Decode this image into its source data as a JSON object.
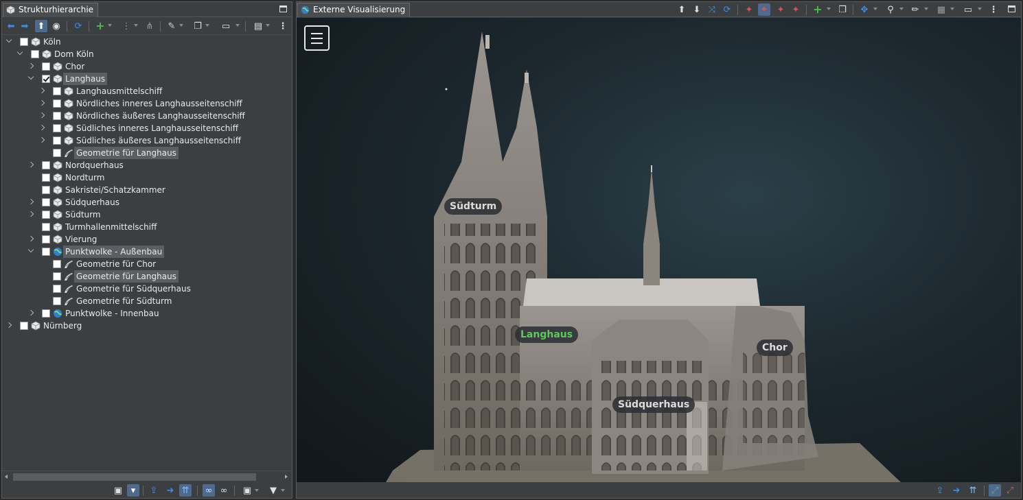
{
  "left_panel": {
    "tab_title": "Strukturhierarchie",
    "tree": [
      {
        "label": "Köln",
        "depth": 0,
        "expander": "down",
        "checked": false,
        "icon": "cube-icon",
        "selected": false
      },
      {
        "label": "Dom Köln",
        "depth": 1,
        "expander": "down",
        "checked": false,
        "icon": "cube-icon",
        "selected": false
      },
      {
        "label": "Chor",
        "depth": 2,
        "expander": "right",
        "checked": false,
        "icon": "cube-icon",
        "selected": false
      },
      {
        "label": "Langhaus",
        "depth": 2,
        "expander": "down",
        "checked": true,
        "icon": "cube-icon",
        "selected": true
      },
      {
        "label": "Langhausmittelschiff",
        "depth": 3,
        "expander": "right",
        "checked": false,
        "icon": "cube-icon",
        "selected": false
      },
      {
        "label": "Nördliches inneres Langhausseitenschiff",
        "depth": 3,
        "expander": "right",
        "checked": false,
        "icon": "cube-icon",
        "selected": false
      },
      {
        "label": "Nördliches äußeres Langhausseitenschiff",
        "depth": 3,
        "expander": "right",
        "checked": false,
        "icon": "cube-icon",
        "selected": false
      },
      {
        "label": "Südliches inneres Langhausseitenschiff",
        "depth": 3,
        "expander": "right",
        "checked": false,
        "icon": "cube-icon",
        "selected": false
      },
      {
        "label": "Südliches äußeres Langhausseitenschiff",
        "depth": 3,
        "expander": "right",
        "checked": false,
        "icon": "cube-icon",
        "selected": false
      },
      {
        "label": "Geometrie für Langhaus",
        "depth": 3,
        "expander": "none",
        "checked": false,
        "icon": "geometry-icon",
        "selected": true
      },
      {
        "label": "Nordquerhaus",
        "depth": 2,
        "expander": "right",
        "checked": false,
        "icon": "cube-icon",
        "selected": false
      },
      {
        "label": "Nordturm",
        "depth": 2,
        "expander": "none",
        "checked": false,
        "icon": "cube-icon",
        "selected": false
      },
      {
        "label": "Sakristei/Schatzkammer",
        "depth": 2,
        "expander": "none",
        "checked": false,
        "icon": "cube-icon",
        "selected": false
      },
      {
        "label": "Südquerhaus",
        "depth": 2,
        "expander": "right",
        "checked": false,
        "icon": "cube-icon",
        "selected": false
      },
      {
        "label": "Südturm",
        "depth": 2,
        "expander": "right",
        "checked": false,
        "icon": "cube-icon",
        "selected": false
      },
      {
        "label": "Turmhallenmittelschiff",
        "depth": 2,
        "expander": "none",
        "checked": false,
        "icon": "cube-icon",
        "selected": false
      },
      {
        "label": "Vierung",
        "depth": 2,
        "expander": "right",
        "checked": false,
        "icon": "cube-icon",
        "selected": false
      },
      {
        "label": "Punktwolke - Außenbau",
        "depth": 2,
        "expander": "down",
        "checked": false,
        "icon": "globe-icon",
        "selected": true
      },
      {
        "label": "Geometrie für Chor",
        "depth": 3,
        "expander": "none",
        "checked": false,
        "icon": "geometry-icon",
        "selected": false
      },
      {
        "label": "Geometrie für Langhaus",
        "depth": 3,
        "expander": "none",
        "checked": false,
        "icon": "geometry-icon",
        "selected": true
      },
      {
        "label": "Geometrie für Südquerhaus",
        "depth": 3,
        "expander": "none",
        "checked": false,
        "icon": "geometry-icon",
        "selected": false
      },
      {
        "label": "Geometrie für Südturm",
        "depth": 3,
        "expander": "none",
        "checked": false,
        "icon": "geometry-icon",
        "selected": false
      },
      {
        "label": "Punktwolke - Innenbau",
        "depth": 2,
        "expander": "right",
        "checked": false,
        "icon": "globe-icon",
        "selected": false
      },
      {
        "label": "Nürnberg",
        "depth": 0,
        "expander": "right",
        "checked": false,
        "icon": "cube-icon",
        "selected": false
      }
    ]
  },
  "right_panel": {
    "tab_title": "Externe Visualisierung",
    "labels_3d": {
      "suedturm": "Südturm",
      "langhaus": "Langhaus",
      "chor": "Chor",
      "suedquerhaus": "Südquerhaus"
    }
  },
  "colors": {
    "highlight_label": "#5cc95c",
    "accent_blue": "#3d8ee8",
    "accent_green": "#4cbf4c",
    "accent_red": "#e05050"
  }
}
